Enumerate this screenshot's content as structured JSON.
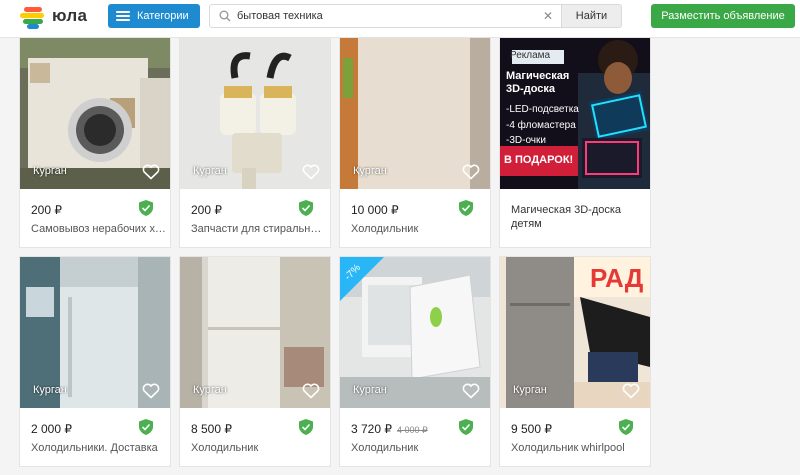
{
  "header": {
    "logo_text": "юла",
    "categories_label": "Категории",
    "search_value": "бытовая техника",
    "clear_icon": "✕",
    "find_label": "Найти",
    "post_label": "Разместить объявление"
  },
  "listings": [
    {
      "city": "Курган",
      "price": "200 ₽",
      "title": "Самовывоз нерабочих холодильников"
    },
    {
      "city": "Курган",
      "price": "200 ₽",
      "title": "Запчасти для стиральной машины"
    },
    {
      "city": "Курган",
      "price": "10 000 ₽",
      "title": "Холодильник"
    },
    {
      "ad_badge": "Реклама",
      "ad_heading": "Магическая 3D-доска",
      "ad_lines": [
        "-LED-подсветка",
        "-4 фломастера",
        "-3D-очки"
      ],
      "ad_gift": "в подарок!",
      "ad_title": "Магическая 3D-доска детям"
    },
    {
      "city": "Курган",
      "price": "2 000 ₽",
      "title": "Холодильники. Доставка"
    },
    {
      "city": "Курган",
      "price": "8 500 ₽",
      "title": "Холодильник"
    },
    {
      "city": "Курган",
      "price": "3 720 ₽",
      "old_price": "4 000 ₽",
      "discount": "-7%",
      "title": "Холодильник"
    },
    {
      "city": "Курган",
      "price": "9 500 ₽",
      "title": "Холодильник whirlpool",
      "banner": "РАД"
    }
  ],
  "colors": {
    "accent_blue": "#1e8bd0",
    "accent_green": "#3aa846",
    "verified_green": "#4caf50"
  }
}
